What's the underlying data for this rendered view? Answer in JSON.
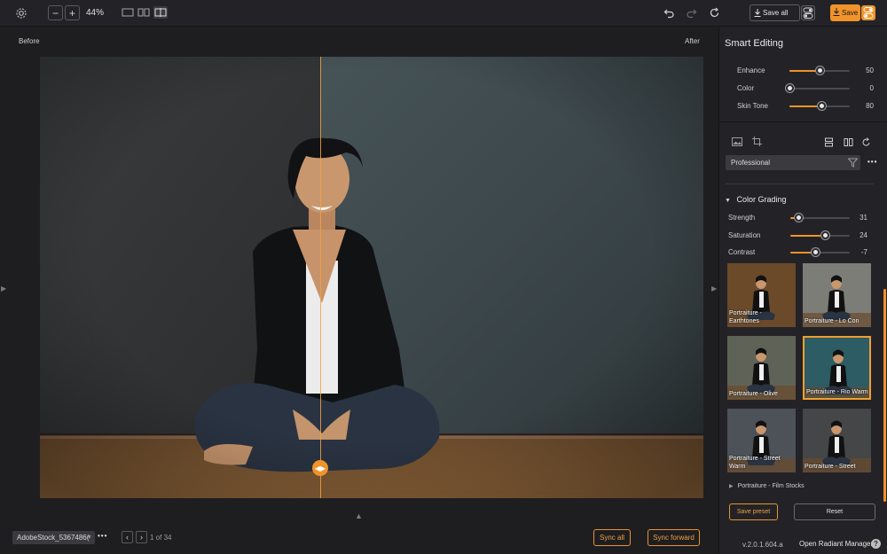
{
  "toolbar": {
    "zoom": "44%",
    "zoom_out": "−",
    "zoom_in": "+",
    "save_all_label": "Save all",
    "save_label": "Save"
  },
  "viewer": {
    "before_label": "Before",
    "after_label": "After"
  },
  "bottom": {
    "filename": "AdobeStock_5367486(",
    "more": "•••",
    "prev": "‹",
    "next": "›",
    "page_count": "1 of 34",
    "sync_all": "Sync all",
    "sync_forward": "Sync forward"
  },
  "panel": {
    "title": "Smart Editing",
    "smart_sliders": [
      {
        "label": "Enhance",
        "value": "50",
        "fraction": 0.5
      },
      {
        "label": "Color",
        "value": "0",
        "fraction": 0.0
      },
      {
        "label": "Skin Tone",
        "value": "80",
        "fraction": 0.54
      }
    ],
    "preset_filter": "Professional",
    "more": "•••",
    "section": "Color Grading",
    "grading_sliders": [
      {
        "label": "Strength",
        "value": "31",
        "fraction": 0.14
      },
      {
        "label": "Saturation",
        "value": "24",
        "fraction": 0.59
      },
      {
        "label": "Contrast",
        "value": "-7",
        "fraction": 0.43
      }
    ],
    "presets": [
      {
        "label": "Portraiture -\nEarthtones",
        "tone": "#6b4a2a",
        "selected": false
      },
      {
        "label": "Portraiture - Lo Con",
        "tone": "#7d7d78",
        "selected": false
      },
      {
        "label": "Portraiture - Olive",
        "tone": "#5f6256",
        "selected": false
      },
      {
        "label": "Portraiture - Rio Warm",
        "tone": "#2d5c64",
        "selected": true
      },
      {
        "label": "Portraiture - Street\nWarm",
        "tone": "#4c5258",
        "selected": false
      },
      {
        "label": "Portraiture - Street",
        "tone": "#444648",
        "selected": false
      }
    ],
    "groups": [
      "Portraiture - Film Stocks"
    ],
    "save_preset": "Save preset",
    "reset": "Reset",
    "version": "v.2.0.1.604.a",
    "manager": "Open Radiant Manager",
    "help": "?"
  },
  "colors": {
    "accent": "#f0932a",
    "panel_bg": "#232327",
    "app_bg": "#1e1e21"
  }
}
